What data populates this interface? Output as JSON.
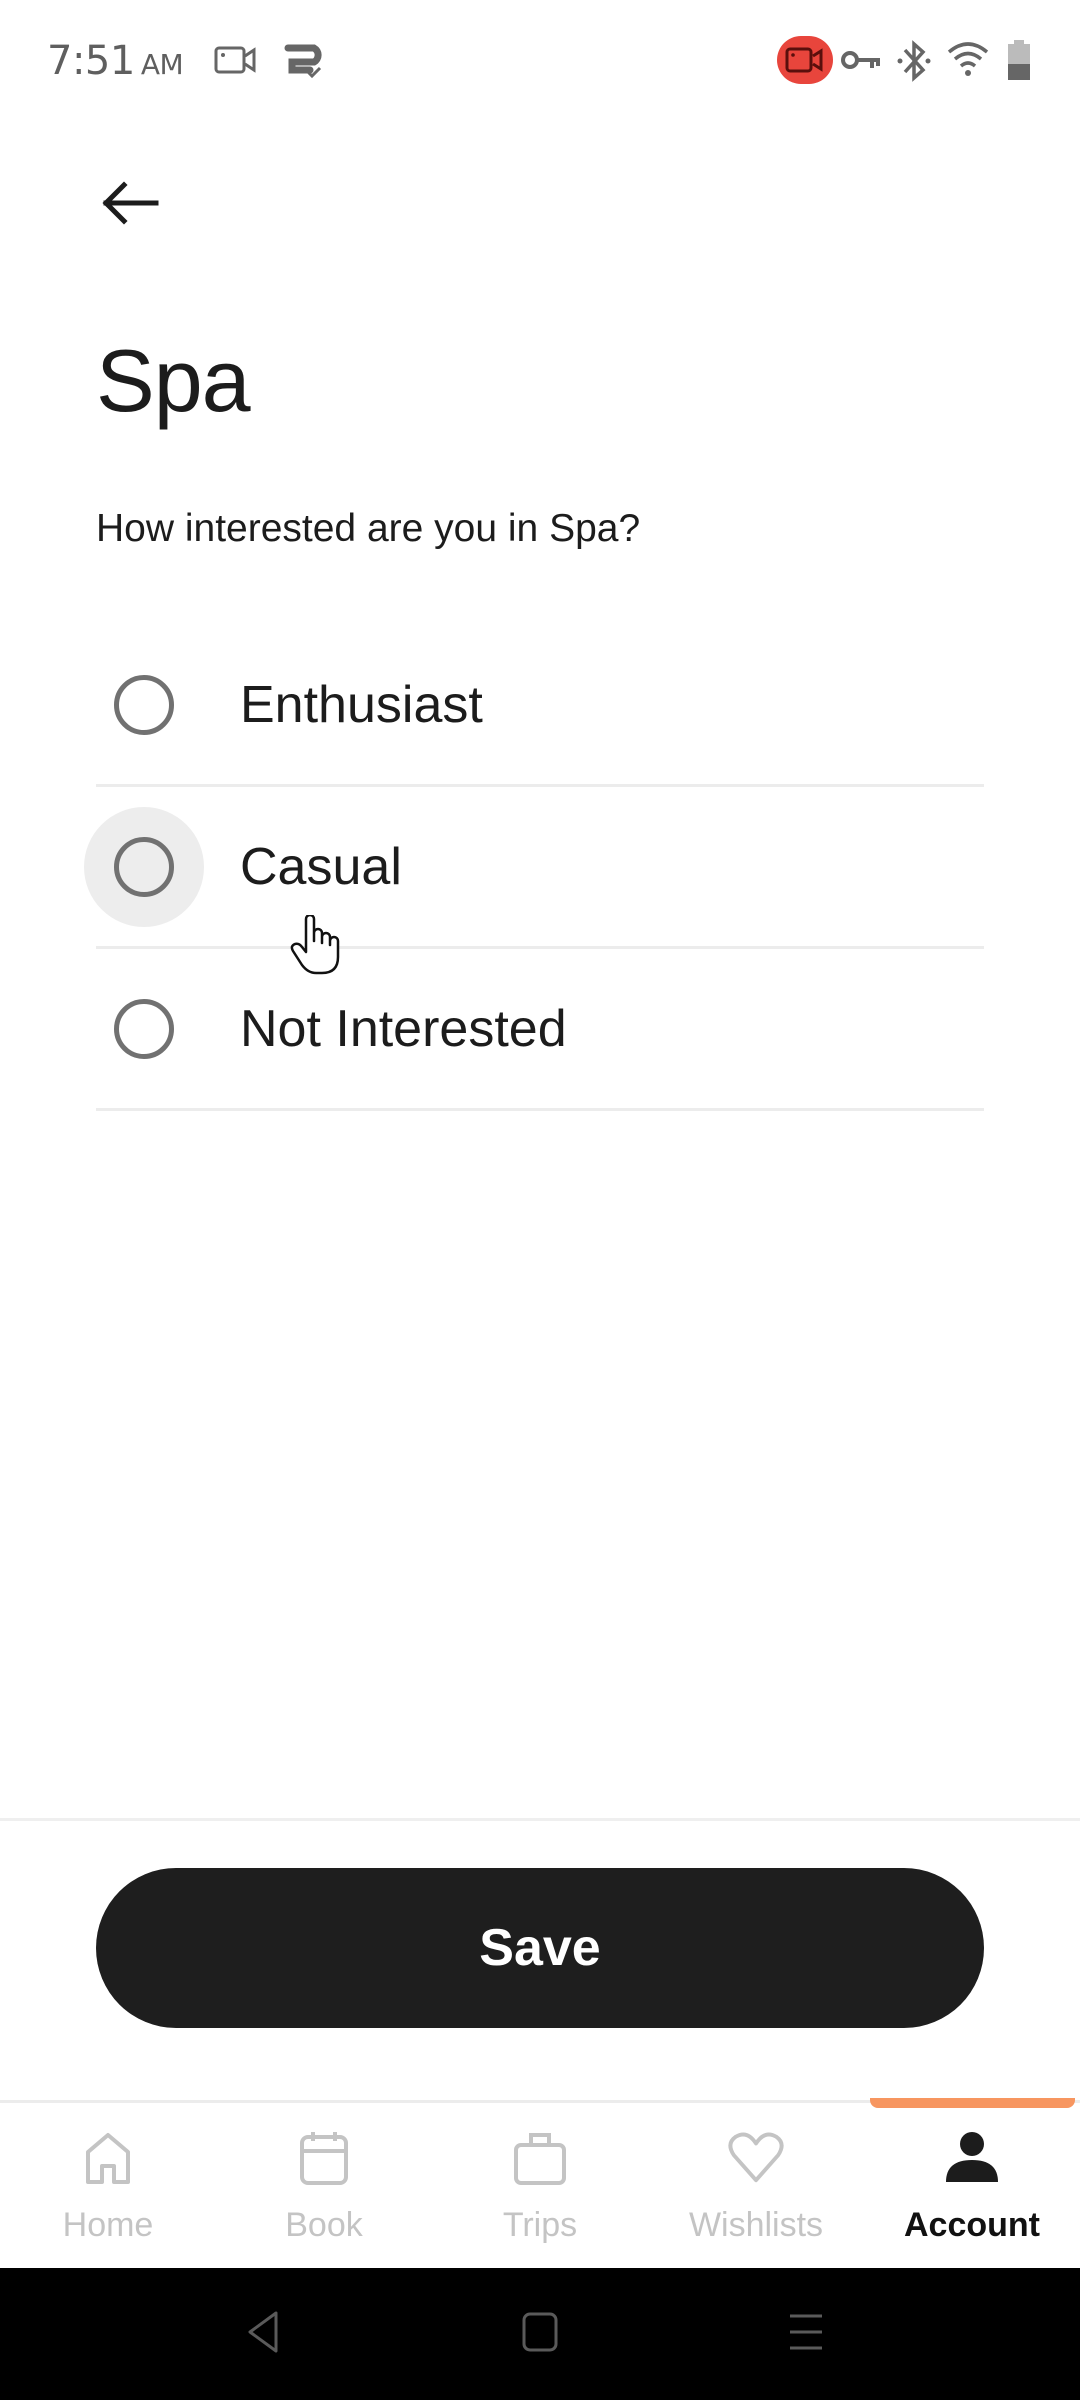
{
  "status_bar": {
    "time": "7:51",
    "ampm": "AM",
    "left_icons": [
      "screen-record-icon",
      "sync-check-icon"
    ],
    "right_icons": [
      "recording-indicator-icon",
      "vpn-key-icon",
      "bluetooth-icon",
      "wifi-icon",
      "battery-icon"
    ],
    "recording_color": "#e8453c"
  },
  "header": {
    "back_icon": "arrow-left-icon",
    "title": "Spa",
    "question": "How interested are you in Spa?"
  },
  "options": [
    {
      "label": "Enthusiast",
      "selected": false
    },
    {
      "label": "Casual",
      "selected": false
    },
    {
      "label": "Not Interested",
      "selected": false
    }
  ],
  "footer": {
    "save_label": "Save"
  },
  "bottom_nav": {
    "accent_color": "#f79660",
    "items": [
      {
        "label": "Home",
        "icon": "home-icon",
        "active": false
      },
      {
        "label": "Book",
        "icon": "calendar-icon",
        "active": false
      },
      {
        "label": "Trips",
        "icon": "briefcase-icon",
        "active": false
      },
      {
        "label": "Wishlists",
        "icon": "heart-icon",
        "active": false
      },
      {
        "label": "Account",
        "icon": "person-icon",
        "active": true
      }
    ]
  },
  "system_nav": {
    "buttons": [
      "back-triangle-icon",
      "home-square-icon",
      "recents-menu-icon"
    ]
  }
}
